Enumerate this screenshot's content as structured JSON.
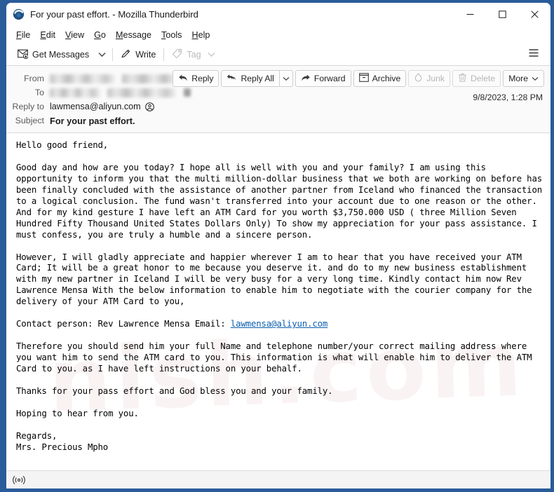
{
  "window": {
    "title": "For your past effort. - Mozilla Thunderbird",
    "logo_icon": "thunderbird-logo-icon",
    "minimize_icon": "minimize-icon",
    "maximize_icon": "maximize-icon",
    "close_icon": "close-icon",
    "frame_color": "#2a5c9a"
  },
  "menubar": {
    "items": [
      {
        "label": "File",
        "accel": "F"
      },
      {
        "label": "Edit",
        "accel": "E"
      },
      {
        "label": "View",
        "accel": "V"
      },
      {
        "label": "Go",
        "accel": "G"
      },
      {
        "label": "Message",
        "accel": "M"
      },
      {
        "label": "Tools",
        "accel": "T"
      },
      {
        "label": "Help",
        "accel": "H"
      }
    ]
  },
  "toolbar": {
    "get_messages_label": "Get Messages",
    "get_messages_icon": "get-messages-icon",
    "get_messages_caret_icon": "chevron-down-icon",
    "write_label": "Write",
    "write_icon": "pencil-icon",
    "tag_label": "Tag",
    "tag_icon": "tag-icon",
    "tag_caret_icon": "chevron-down-icon",
    "tag_disabled": true,
    "app_menu_icon": "hamburger-menu-icon"
  },
  "header": {
    "from_label": "From",
    "from_value_redacted": true,
    "to_label": "To",
    "to_value_redacted": true,
    "replyto_label": "Reply to",
    "replyto_value": "lawmensa@aliyun.com",
    "replyto_contact_icon": "contact-avatar-icon",
    "subject_label": "Subject",
    "subject_value": "For your past effort.",
    "date": "9/8/2023, 1:28 PM",
    "actions": [
      {
        "label": "Reply",
        "icon": "reply-icon",
        "disabled": false,
        "caret": false
      },
      {
        "label": "Reply All",
        "icon": "reply-all-icon",
        "disabled": false,
        "caret": true
      },
      {
        "label": "Forward",
        "icon": "forward-icon",
        "disabled": false,
        "caret": false
      },
      {
        "label": "Archive",
        "icon": "archive-icon",
        "disabled": false,
        "caret": false
      },
      {
        "label": "Junk",
        "icon": "junk-icon",
        "disabled": true,
        "caret": false
      },
      {
        "label": "Delete",
        "icon": "trash-icon",
        "disabled": true,
        "caret": false
      },
      {
        "label": "More",
        "icon": null,
        "disabled": false,
        "caret": true
      }
    ]
  },
  "body": {
    "watermark_text": "nish.com",
    "link_text": "lawmensa@aliyun.com",
    "paragraphs": [
      "Hello good friend,",
      "",
      "Good day and how are you today? I hope all is well with you and your family? I am using this opportunity to inform you that the multi million-dollar business that we both are working on before has been finally concluded with the assistance of another partner from Iceland who financed the transaction to a logical conclusion. The fund wasn't transferred into your account due to one reason or the other. And for my kind gesture I have left an ATM Card for you worth $3,750.000 USD ( three Million Seven Hundred Fifty Thousand United States Dollars Only) To show my appreciation for your pass assistance. I must confess, you are truly a humble and a sincere person.",
      "",
      "However, I will gladly appreciate and happier wherever I am to hear that you have received your ATM Card; It will be a great honor to me because you deserve it. and do to my new business establishment with my new partner in Iceland I will be very busy for a very long time. Kindly contact him now Rev Lawrence Mensa With the below information to enable him to negotiate with the courier company for the delivery of your ATM Card to you,",
      "",
      "Contact person: Rev Lawrence Mensa Email: {{LINK}}",
      "",
      "Therefore you should send him your full Name and telephone number/your correct mailing address where you want him to send the ATM card to you. This information is what will enable him to deliver the ATM Card to you. as I have left instructions on your behalf.",
      "",
      "Thanks for your pass effort and God bless you and your family.",
      "",
      "Hoping to hear from you.",
      "",
      "Regards,",
      "Mrs. Precious Mpho"
    ]
  },
  "statusbar": {
    "icon": "online-status-icon",
    "text": ""
  }
}
